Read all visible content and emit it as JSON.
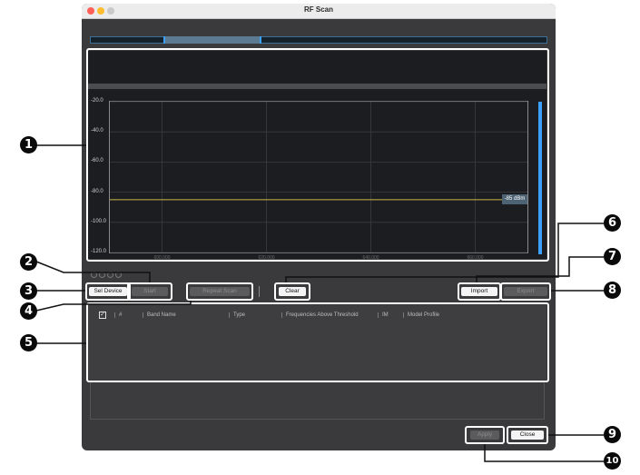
{
  "window": {
    "title": "RF Scan"
  },
  "chart_data": {
    "type": "line",
    "y_ticks": [
      "-20.0",
      "-40.0",
      "-60.0",
      "-80.0",
      "-100.0",
      "-120.0"
    ],
    "ylim": [
      -120,
      -20
    ],
    "grid": true,
    "threshold": {
      "value": -85,
      "label": "-85",
      "unit": "dBm"
    },
    "x_ticks": [
      "600.000",
      "620.000",
      "640.000",
      "660.000"
    ]
  },
  "buttons": {
    "sel_device": "Sel Device",
    "start": "Start",
    "repeat_scan": "Repeat Scan",
    "clear": "Clear",
    "import": "Import",
    "export": "Export",
    "apply": "Apply",
    "close": "Close"
  },
  "table": {
    "headers": [
      "#",
      "Band Name",
      "Type",
      "Frequencies Above Threshold",
      "IM",
      "Model Profile"
    ]
  },
  "callouts": [
    "1",
    "2",
    "3",
    "4",
    "5",
    "6",
    "7",
    "8",
    "9",
    "10"
  ]
}
